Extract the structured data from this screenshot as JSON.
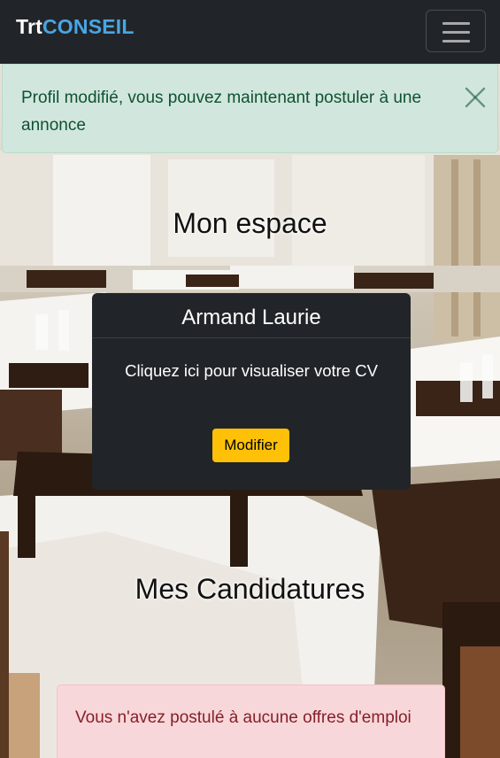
{
  "navbar": {
    "brand_part1": "Trt",
    "brand_part2": "CONSEIL",
    "brand_part1_color": "#ffffff",
    "brand_part2_color": "#49a6e3",
    "toggler_icon": "hamburger-menu-icon"
  },
  "alerts": {
    "success_message": "Profil modifié, vous pouvez maintenant postuler à une annonce",
    "close_icon": "close-icon",
    "empty_applications_message": "Vous n'avez postulé à aucune offres d'emploi"
  },
  "espace": {
    "title": "Mon espace",
    "card": {
      "name": "Armand Laurie",
      "cv_link": "Cliquez ici pour visualiser votre CV",
      "edit_button": "Modifier",
      "edit_button_color": "#ffc107"
    }
  },
  "candidatures": {
    "title": "Mes Candidatures"
  }
}
